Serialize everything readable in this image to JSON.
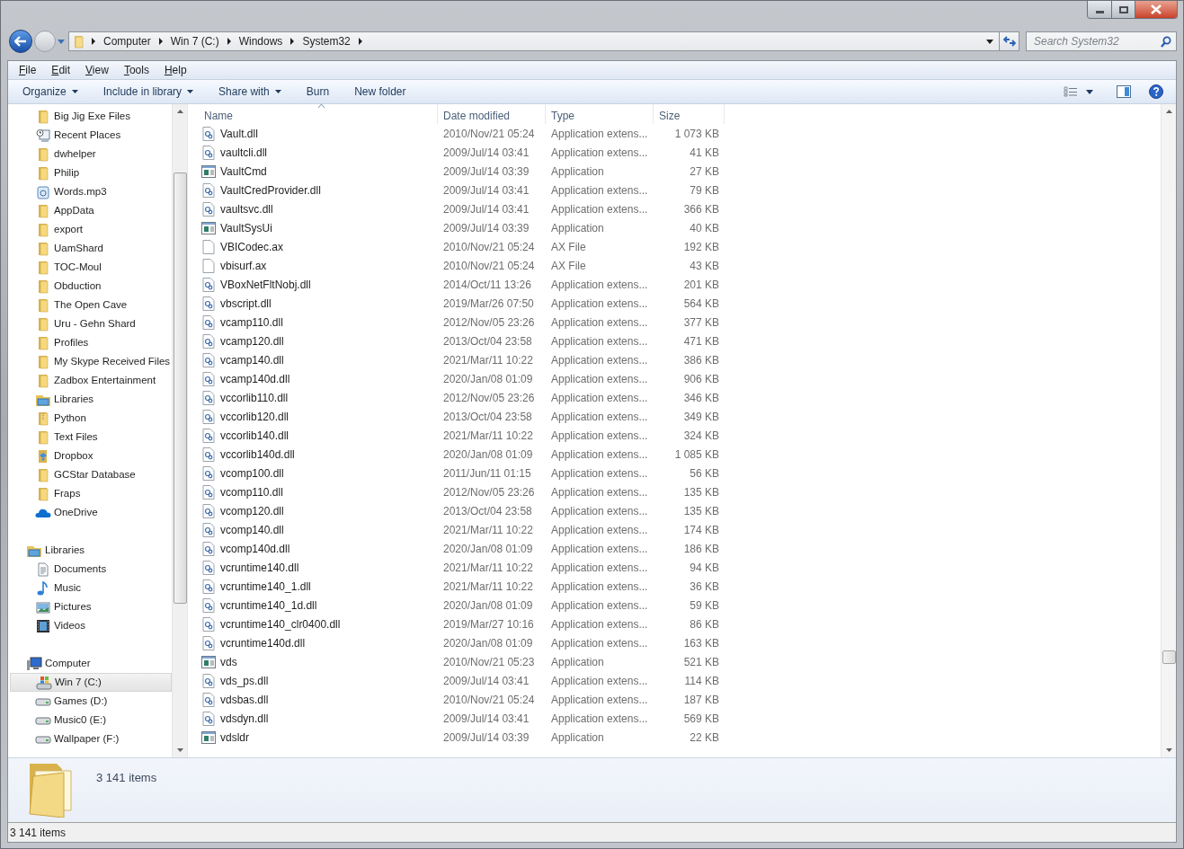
{
  "address": {
    "crumbs": [
      "Computer",
      "Win 7 (C:)",
      "Windows",
      "System32"
    ]
  },
  "search": {
    "placeholder": "Search System32"
  },
  "menu": [
    "File",
    "Edit",
    "View",
    "Tools",
    "Help"
  ],
  "toolbar": [
    {
      "label": "Organize",
      "dropdown": true
    },
    {
      "label": "Include in library",
      "dropdown": true
    },
    {
      "label": "Share with",
      "dropdown": true
    },
    {
      "label": "Burn",
      "dropdown": false
    },
    {
      "label": "New folder",
      "dropdown": false
    }
  ],
  "sidebar": {
    "sections": [
      {
        "items": [
          {
            "label": "Big Jig Exe Files",
            "kind": "folder",
            "selected": false
          },
          {
            "label": "Recent Places",
            "kind": "recent",
            "selected": false
          },
          {
            "label": "dwhelper",
            "kind": "folder",
            "selected": false
          },
          {
            "label": "Philip",
            "kind": "folder",
            "selected": false
          },
          {
            "label": "Words.mp3",
            "kind": "audio",
            "selected": false
          },
          {
            "label": "AppData",
            "kind": "folder",
            "selected": false
          },
          {
            "label": "export",
            "kind": "folder",
            "selected": false
          },
          {
            "label": "UamShard",
            "kind": "folder",
            "selected": false
          },
          {
            "label": "TOC-Moul",
            "kind": "folder",
            "selected": false
          },
          {
            "label": "Obduction",
            "kind": "folder",
            "selected": false
          },
          {
            "label": "The Open Cave",
            "kind": "folder",
            "selected": false
          },
          {
            "label": "Uru - Gehn Shard",
            "kind": "folder",
            "selected": false
          },
          {
            "label": "Profiles",
            "kind": "folder",
            "selected": false
          },
          {
            "label": "My Skype Received Files",
            "kind": "folder",
            "selected": false
          },
          {
            "label": "Zadbox Entertainment",
            "kind": "folder",
            "selected": false
          },
          {
            "label": "Libraries",
            "kind": "library",
            "selected": false
          },
          {
            "label": "Python",
            "kind": "zipfolder",
            "selected": false
          },
          {
            "label": "Text Files",
            "kind": "folder",
            "selected": false
          },
          {
            "label": "Dropbox",
            "kind": "dropbox",
            "selected": false
          },
          {
            "label": "GCStar Database",
            "kind": "folder",
            "selected": false
          },
          {
            "label": "Fraps",
            "kind": "folder",
            "selected": false
          },
          {
            "label": "OneDrive",
            "kind": "cloud",
            "selected": false
          }
        ]
      },
      {
        "header": {
          "label": "Libraries",
          "kind": "library"
        },
        "items": [
          {
            "label": "Documents",
            "kind": "document",
            "selected": false
          },
          {
            "label": "Music",
            "kind": "music",
            "selected": false
          },
          {
            "label": "Pictures",
            "kind": "pictures",
            "selected": false
          },
          {
            "label": "Videos",
            "kind": "videos",
            "selected": false
          }
        ]
      },
      {
        "header": {
          "label": "Computer",
          "kind": "computer"
        },
        "items": [
          {
            "label": "Win 7 (C:)",
            "kind": "windrive",
            "selected": true
          },
          {
            "label": "Games (D:)",
            "kind": "drive",
            "selected": false
          },
          {
            "label": "Music0 (E:)",
            "kind": "drive",
            "selected": false
          },
          {
            "label": "Wallpaper (F:)",
            "kind": "drive",
            "selected": false
          }
        ]
      }
    ]
  },
  "table": {
    "columns": [
      {
        "label": "Name",
        "sorted": true
      },
      {
        "label": "Date modified",
        "sorted": false
      },
      {
        "label": "Type",
        "sorted": false
      },
      {
        "label": "Size",
        "sorted": false
      }
    ],
    "rows": [
      {
        "kind": "dll",
        "name": "Vault.dll",
        "date": "2010/Nov/21 05:24",
        "type": "Application extens...",
        "size": "1 073 KB"
      },
      {
        "kind": "dll",
        "name": "vaultcli.dll",
        "date": "2009/Jul/14 03:41",
        "type": "Application extens...",
        "size": "41 KB"
      },
      {
        "kind": "app",
        "name": "VaultCmd",
        "date": "2009/Jul/14 03:39",
        "type": "Application",
        "size": "27 KB"
      },
      {
        "kind": "dll",
        "name": "VaultCredProvider.dll",
        "date": "2009/Jul/14 03:41",
        "type": "Application extens...",
        "size": "79 KB"
      },
      {
        "kind": "dll",
        "name": "vaultsvc.dll",
        "date": "2009/Jul/14 03:41",
        "type": "Application extens...",
        "size": "366 KB"
      },
      {
        "kind": "app",
        "name": "VaultSysUi",
        "date": "2009/Jul/14 03:39",
        "type": "Application",
        "size": "40 KB"
      },
      {
        "kind": "file",
        "name": "VBICodec.ax",
        "date": "2010/Nov/21 05:24",
        "type": "AX File",
        "size": "192 KB"
      },
      {
        "kind": "file",
        "name": "vbisurf.ax",
        "date": "2010/Nov/21 05:24",
        "type": "AX File",
        "size": "43 KB"
      },
      {
        "kind": "dll",
        "name": "VBoxNetFltNobj.dll",
        "date": "2014/Oct/11 13:26",
        "type": "Application extens...",
        "size": "201 KB"
      },
      {
        "kind": "dll",
        "name": "vbscript.dll",
        "date": "2019/Mar/26 07:50",
        "type": "Application extens...",
        "size": "564 KB"
      },
      {
        "kind": "dll",
        "name": "vcamp110.dll",
        "date": "2012/Nov/05 23:26",
        "type": "Application extens...",
        "size": "377 KB"
      },
      {
        "kind": "dll",
        "name": "vcamp120.dll",
        "date": "2013/Oct/04 23:58",
        "type": "Application extens...",
        "size": "471 KB"
      },
      {
        "kind": "dll",
        "name": "vcamp140.dll",
        "date": "2021/Mar/11 10:22",
        "type": "Application extens...",
        "size": "386 KB"
      },
      {
        "kind": "dll",
        "name": "vcamp140d.dll",
        "date": "2020/Jan/08 01:09",
        "type": "Application extens...",
        "size": "906 KB"
      },
      {
        "kind": "dll",
        "name": "vccorlib110.dll",
        "date": "2012/Nov/05 23:26",
        "type": "Application extens...",
        "size": "346 KB"
      },
      {
        "kind": "dll",
        "name": "vccorlib120.dll",
        "date": "2013/Oct/04 23:58",
        "type": "Application extens...",
        "size": "349 KB"
      },
      {
        "kind": "dll",
        "name": "vccorlib140.dll",
        "date": "2021/Mar/11 10:22",
        "type": "Application extens...",
        "size": "324 KB"
      },
      {
        "kind": "dll",
        "name": "vccorlib140d.dll",
        "date": "2020/Jan/08 01:09",
        "type": "Application extens...",
        "size": "1 085 KB"
      },
      {
        "kind": "dll",
        "name": "vcomp100.dll",
        "date": "2011/Jun/11 01:15",
        "type": "Application extens...",
        "size": "56 KB"
      },
      {
        "kind": "dll",
        "name": "vcomp110.dll",
        "date": "2012/Nov/05 23:26",
        "type": "Application extens...",
        "size": "135 KB"
      },
      {
        "kind": "dll",
        "name": "vcomp120.dll",
        "date": "2013/Oct/04 23:58",
        "type": "Application extens...",
        "size": "135 KB"
      },
      {
        "kind": "dll",
        "name": "vcomp140.dll",
        "date": "2021/Mar/11 10:22",
        "type": "Application extens...",
        "size": "174 KB"
      },
      {
        "kind": "dll",
        "name": "vcomp140d.dll",
        "date": "2020/Jan/08 01:09",
        "type": "Application extens...",
        "size": "186 KB"
      },
      {
        "kind": "dll",
        "name": "vcruntime140.dll",
        "date": "2021/Mar/11 10:22",
        "type": "Application extens...",
        "size": "94 KB"
      },
      {
        "kind": "dll",
        "name": "vcruntime140_1.dll",
        "date": "2021/Mar/11 10:22",
        "type": "Application extens...",
        "size": "36 KB"
      },
      {
        "kind": "dll",
        "name": "vcruntime140_1d.dll",
        "date": "2020/Jan/08 01:09",
        "type": "Application extens...",
        "size": "59 KB"
      },
      {
        "kind": "dll",
        "name": "vcruntime140_clr0400.dll",
        "date": "2019/Mar/27 10:16",
        "type": "Application extens...",
        "size": "86 KB"
      },
      {
        "kind": "dll",
        "name": "vcruntime140d.dll",
        "date": "2020/Jan/08 01:09",
        "type": "Application extens...",
        "size": "163 KB"
      },
      {
        "kind": "app",
        "name": "vds",
        "date": "2010/Nov/21 05:23",
        "type": "Application",
        "size": "521 KB"
      },
      {
        "kind": "dll",
        "name": "vds_ps.dll",
        "date": "2009/Jul/14 03:41",
        "type": "Application extens...",
        "size": "114 KB"
      },
      {
        "kind": "dll",
        "name": "vdsbas.dll",
        "date": "2010/Nov/21 05:24",
        "type": "Application extens...",
        "size": "187 KB"
      },
      {
        "kind": "dll",
        "name": "vdsdyn.dll",
        "date": "2009/Jul/14 03:41",
        "type": "Application extens...",
        "size": "569 KB"
      },
      {
        "kind": "app",
        "name": "vdsldr",
        "date": "2009/Jul/14 03:39",
        "type": "Application",
        "size": "22 KB"
      }
    ]
  },
  "details_pane": {
    "summary": "3 141 items"
  },
  "status_bar": {
    "text": "3 141 items"
  }
}
